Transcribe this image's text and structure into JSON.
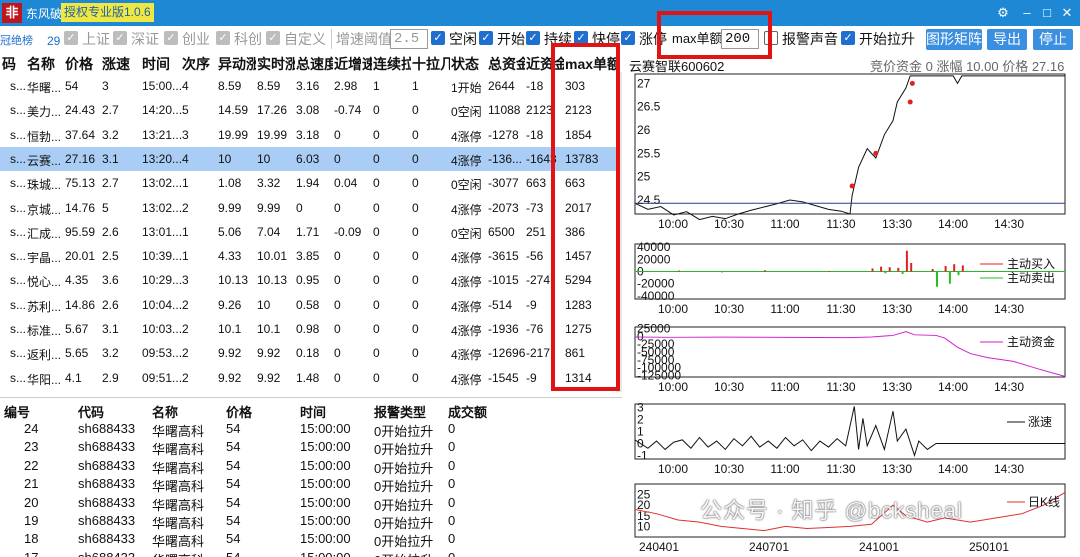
{
  "app": {
    "logo_glyph": "非",
    "title": "东风破",
    "version": "授权专业版1.0.6"
  },
  "window_controls": {
    "settings": "⚙",
    "minimize": "–",
    "maximize": "□",
    "close": "✕"
  },
  "toolbar": {
    "partial_label": "冠绝榜",
    "count": "29",
    "market_shanghai": "上证",
    "market_shenzhen": "深证",
    "market_chinext": "创业",
    "market_star": "科创",
    "market_custom": "自定义",
    "speed_threshold_label": "增速阈值",
    "speed_threshold_value": "2.5",
    "empty_flag": "空闲",
    "start_flag": "开始",
    "continue_flag": "持续",
    "fast_stop_flag": "快停",
    "limit_up_flag": "涨停",
    "max_order_label": "max单额",
    "max_order_value": "200",
    "alarm_sound": "报警声音",
    "start_pull": "开始拉升",
    "chart_matrix_btn": "图形矩阵",
    "export_btn": "导出",
    "stop_btn": "停止"
  },
  "top_table": {
    "headers": [
      "码",
      "名称",
      "价格",
      "涨速",
      "时间",
      "次序",
      "异动涨",
      "实时涨",
      "总速度",
      "近增速",
      "连续拉",
      "十拉几",
      "状态",
      "总资金",
      "近资金",
      "max单额"
    ],
    "rows": [
      [
        "s...",
        "华曙...",
        "54",
        "3",
        "15:00...",
        "4",
        "8.59",
        "8.59",
        "3.16",
        "2.98",
        "1",
        "1",
        "1开始",
        "2644",
        "-18",
        "303"
      ],
      [
        "s...",
        "美力...",
        "24.43",
        "2.7",
        "14:20...",
        "5",
        "14.59",
        "17.26",
        "3.08",
        "-0.74",
        "0",
        "0",
        "0空闲",
        "11088",
        "2123",
        "2123"
      ],
      [
        "s...",
        "恒勃...",
        "37.64",
        "3.2",
        "13:21...",
        "3",
        "19.99",
        "19.99",
        "3.18",
        "0",
        "0",
        "0",
        "4涨停",
        "-1278",
        "-18",
        "1854"
      ],
      [
        "s...",
        "云赛...",
        "27.16",
        "3.1",
        "13:20...",
        "4",
        "10",
        "10",
        "6.03",
        "0",
        "0",
        "0",
        "4涨停",
        "-136...",
        "-1643",
        "13783"
      ],
      [
        "s...",
        "珠城...",
        "75.13",
        "2.7",
        "13:02...",
        "1",
        "1.08",
        "3.32",
        "1.94",
        "0.04",
        "0",
        "0",
        "0空闲",
        "-3077",
        "663",
        "663"
      ],
      [
        "s...",
        "京城...",
        "14.76",
        "5",
        "13:02...",
        "2",
        "9.99",
        "9.99",
        "0",
        "0",
        "0",
        "0",
        "4涨停",
        "-2073",
        "-73",
        "2017"
      ],
      [
        "s...",
        "汇成...",
        "95.59",
        "2.6",
        "13:01...",
        "1",
        "5.06",
        "7.04",
        "1.71",
        "-0.09",
        "0",
        "0",
        "0空闲",
        "6500",
        "251",
        "386"
      ],
      [
        "s...",
        "宇晶...",
        "20.01",
        "2.5",
        "10:39...",
        "1",
        "4.33",
        "10.01",
        "3.85",
        "0",
        "0",
        "0",
        "4涨停",
        "-3615",
        "-56",
        "1457"
      ],
      [
        "s...",
        "悦心...",
        "4.35",
        "3.6",
        "10:29...",
        "3",
        "10.13",
        "10.13",
        "0.95",
        "0",
        "0",
        "0",
        "4涨停",
        "-1015",
        "-274",
        "5294"
      ],
      [
        "s...",
        "苏利...",
        "14.86",
        "2.6",
        "10:04...",
        "2",
        "9.26",
        "10",
        "0.58",
        "0",
        "0",
        "0",
        "4涨停",
        "-514",
        "-9",
        "1283"
      ],
      [
        "s...",
        "标准...",
        "5.67",
        "3.1",
        "10:03...",
        "2",
        "10.1",
        "10.1",
        "0.98",
        "0",
        "0",
        "0",
        "4涨停",
        "-1936",
        "-76",
        "1275"
      ],
      [
        "s...",
        "返利...",
        "5.65",
        "3.2",
        "09:53...",
        "2",
        "9.92",
        "9.92",
        "0.18",
        "0",
        "0",
        "0",
        "4涨停",
        "-12696",
        "-217",
        "861"
      ],
      [
        "s...",
        "华阳...",
        "4.1",
        "2.9",
        "09:51...",
        "2",
        "9.92",
        "9.92",
        "1.48",
        "0",
        "0",
        "0",
        "4涨停",
        "-1545",
        "-9",
        "1314"
      ]
    ]
  },
  "bottom_table": {
    "headers": [
      "编号",
      "代码",
      "名称",
      "价格",
      "时间",
      "报警类型",
      "成交额"
    ],
    "rows": [
      [
        "24",
        "sh688433",
        "华曙高科",
        "54",
        "15:00:00",
        "0开始拉升",
        "0"
      ],
      [
        "23",
        "sh688433",
        "华曙高科",
        "54",
        "15:00:00",
        "0开始拉升",
        "0"
      ],
      [
        "22",
        "sh688433",
        "华曙高科",
        "54",
        "15:00:00",
        "0开始拉升",
        "0"
      ],
      [
        "21",
        "sh688433",
        "华曙高科",
        "54",
        "15:00:00",
        "0开始拉升",
        "0"
      ],
      [
        "20",
        "sh688433",
        "华曙高科",
        "54",
        "15:00:00",
        "0开始拉升",
        "0"
      ],
      [
        "19",
        "sh688433",
        "华曙高科",
        "54",
        "15:00:00",
        "0开始拉升",
        "0"
      ],
      [
        "18",
        "sh688433",
        "华曙高科",
        "54",
        "15:00:00",
        "0开始拉升",
        "0"
      ],
      [
        "17",
        "sh688433",
        "华曙高科",
        "54",
        "15:00:00",
        "0开始拉升",
        "0"
      ]
    ]
  },
  "charts": {
    "stock_name": "云赛智联600602",
    "info": "竞价资金 0 涨幅 10.00 价格 27.16",
    "time_ticks": [
      "10:00",
      "10:30",
      "11:00",
      "11:30",
      "13:30",
      "14:00",
      "14:30"
    ],
    "price_yticks": [
      "27",
      "26.5",
      "26",
      "25.5",
      "25",
      "24.5"
    ],
    "flow_yticks": [
      "40000",
      "20000",
      "0",
      "-20000",
      "-40000"
    ],
    "legend_buy": "主动买入",
    "legend_sell": "主动卖出",
    "fund_yticks": [
      "25000",
      "0",
      "-25000",
      "-50000",
      "-75000",
      "-100000",
      "-125000"
    ],
    "legend_fund": "主动资金",
    "speed_yticks": [
      "3",
      "2",
      "1",
      "0",
      "-1"
    ],
    "legend_speed": "涨速",
    "k_yticks": [
      "25",
      "20",
      "15",
      "10"
    ],
    "legend_k": "日K线",
    "date_ticks": [
      "240401",
      "240701",
      "241001",
      "250101"
    ]
  },
  "chart_data": [
    {
      "type": "line",
      "name": "price",
      "ylim": [
        24.2,
        27.2
      ],
      "points": [
        [
          0,
          24.43
        ],
        [
          0.03,
          24.3
        ],
        [
          0.06,
          24.36
        ],
        [
          0.09,
          24.18
        ],
        [
          0.12,
          24.25
        ],
        [
          0.15,
          24.08
        ],
        [
          0.18,
          24.15
        ],
        [
          0.21,
          24.1
        ],
        [
          0.24,
          24.2
        ],
        [
          0.27,
          24.28
        ],
        [
          0.3,
          24.35
        ],
        [
          0.33,
          24.42
        ],
        [
          0.36,
          24.5
        ],
        [
          0.39,
          24.46
        ],
        [
          0.42,
          24.38
        ],
        [
          0.45,
          24.3
        ],
        [
          0.48,
          24.26
        ],
        [
          0.5,
          24.2
        ],
        [
          0.505,
          24.6
        ],
        [
          0.52,
          25.2
        ],
        [
          0.54,
          25.6
        ],
        [
          0.56,
          25.4
        ],
        [
          0.58,
          25.9
        ],
        [
          0.6,
          26.2
        ],
        [
          0.61,
          26.6
        ],
        [
          0.63,
          26.9
        ],
        [
          0.64,
          27.16
        ],
        [
          0.7,
          27.16
        ],
        [
          0.74,
          27.16
        ],
        [
          0.75,
          27.0
        ],
        [
          0.76,
          27.16
        ],
        [
          0.78,
          27.16
        ],
        [
          1,
          27.16
        ]
      ],
      "markers": [
        [
          0.505,
          24.8
        ],
        [
          0.56,
          25.5
        ],
        [
          0.64,
          26.6
        ],
        [
          0.645,
          27.0
        ]
      ],
      "refline": 24.43
    },
    {
      "type": "bar",
      "name": "flow",
      "ylim": [
        -45000,
        45000
      ],
      "buy": [
        [
          0.55,
          5000
        ],
        [
          0.57,
          8000
        ],
        [
          0.59,
          7000
        ],
        [
          0.61,
          6000
        ],
        [
          0.63,
          34000
        ],
        [
          0.64,
          14000
        ],
        [
          0.69,
          4000
        ],
        [
          0.72,
          9000
        ],
        [
          0.74,
          12000
        ],
        [
          0.76,
          10000
        ],
        [
          0.1,
          1500
        ],
        [
          0.3,
          2000
        ],
        [
          0.45,
          1000
        ]
      ],
      "sell": [
        [
          0.58,
          -3000
        ],
        [
          0.62,
          -4000
        ],
        [
          0.7,
          -25000
        ],
        [
          0.73,
          -20000
        ],
        [
          0.75,
          -6000
        ],
        [
          0.2,
          -1500
        ],
        [
          0.4,
          -1000
        ]
      ]
    },
    {
      "type": "line",
      "name": "fund",
      "ylim": [
        -130000,
        30000
      ],
      "points": [
        [
          0,
          -2000
        ],
        [
          0.08,
          -3000
        ],
        [
          0.2,
          -2500
        ],
        [
          0.35,
          -3000
        ],
        [
          0.5,
          -4000
        ],
        [
          0.55,
          -2000
        ],
        [
          0.6,
          3000
        ],
        [
          0.63,
          15000
        ],
        [
          0.65,
          5000
        ],
        [
          0.7,
          3000
        ],
        [
          0.72,
          -5000
        ],
        [
          0.75,
          -35000
        ],
        [
          0.78,
          -55000
        ],
        [
          0.82,
          -68000
        ],
        [
          0.88,
          -80000
        ],
        [
          0.94,
          -105000
        ],
        [
          1,
          -128000
        ]
      ]
    },
    {
      "type": "line",
      "name": "speed",
      "ylim": [
        -1.3,
        3.3
      ],
      "points": [
        [
          0,
          0.3
        ],
        [
          0.03,
          -0.4
        ],
        [
          0.05,
          0.2
        ],
        [
          0.07,
          -0.5
        ],
        [
          0.09,
          0.1
        ],
        [
          0.11,
          0.3
        ],
        [
          0.13,
          -0.4
        ],
        [
          0.15,
          0.5
        ],
        [
          0.17,
          -0.3
        ],
        [
          0.19,
          0.2
        ],
        [
          0.21,
          -0.5
        ],
        [
          0.23,
          0.4
        ],
        [
          0.25,
          -0.2
        ],
        [
          0.27,
          0.6
        ],
        [
          0.29,
          -0.3
        ],
        [
          0.31,
          0.2
        ],
        [
          0.33,
          -0.4
        ],
        [
          0.35,
          0.5
        ],
        [
          0.37,
          -0.2
        ],
        [
          0.39,
          0.3
        ],
        [
          0.41,
          -0.6
        ],
        [
          0.43,
          0.2
        ],
        [
          0.45,
          -0.3
        ],
        [
          0.47,
          0.4
        ],
        [
          0.49,
          -0.2
        ],
        [
          0.51,
          3.1
        ],
        [
          0.52,
          -0.5
        ],
        [
          0.53,
          2.1
        ],
        [
          0.54,
          -0.2
        ],
        [
          0.56,
          1.5
        ],
        [
          0.58,
          -0.5
        ],
        [
          0.6,
          2.7
        ],
        [
          0.61,
          0.2
        ],
        [
          0.63,
          1.2
        ],
        [
          0.65,
          -1
        ],
        [
          0.66,
          0.2
        ],
        [
          0.68,
          -0.5
        ],
        [
          0.7,
          0
        ],
        [
          1,
          0
        ]
      ]
    },
    {
      "type": "line",
      "name": "daily_k",
      "ylim": [
        5,
        30
      ],
      "points": [
        [
          0,
          18
        ],
        [
          0.05,
          16
        ],
        [
          0.1,
          13
        ],
        [
          0.15,
          12
        ],
        [
          0.2,
          10
        ],
        [
          0.25,
          9
        ],
        [
          0.3,
          8
        ],
        [
          0.35,
          10
        ],
        [
          0.4,
          9
        ],
        [
          0.45,
          9.5
        ],
        [
          0.5,
          10
        ],
        [
          0.55,
          11
        ],
        [
          0.6,
          20
        ],
        [
          0.63,
          15
        ],
        [
          0.68,
          12
        ],
        [
          0.72,
          14
        ],
        [
          0.78,
          12
        ],
        [
          0.84,
          14
        ],
        [
          0.9,
          16
        ],
        [
          0.95,
          20
        ],
        [
          1,
          26
        ]
      ]
    }
  ]
}
